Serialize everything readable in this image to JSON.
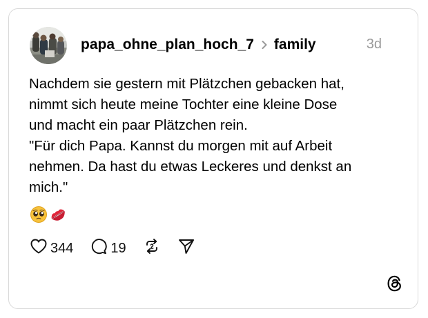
{
  "post": {
    "username": "papa_ohne_plan_hoch_7",
    "community": "family",
    "time": "3d",
    "body_lines": [
      "Nachdem sie gestern mit Plätzchen gebacken hat,",
      "nimmt sich heute meine Tochter eine kleine Dose",
      "und macht ein paar Plätzchen rein.",
      "\"Für dich Papa. Kannst du morgen mit auf Arbeit",
      "nehmen. Da hast du etwas Leckeres und denkst an",
      "mich.\""
    ],
    "emojis": [
      "pleading-face-emoji",
      "kiss-mark-emoji"
    ]
  },
  "actions": {
    "likes": "344",
    "replies": "19"
  },
  "icons": {
    "like": "heart-icon",
    "reply": "comment-icon",
    "repost": "repost-icon",
    "share": "send-icon",
    "brand": "threads-logo"
  },
  "colors": {
    "text": "#000000",
    "muted": "#999999",
    "border": "#d9d9d9",
    "kiss": "#e0263a",
    "emoji_yellow": "#f7c23c"
  }
}
